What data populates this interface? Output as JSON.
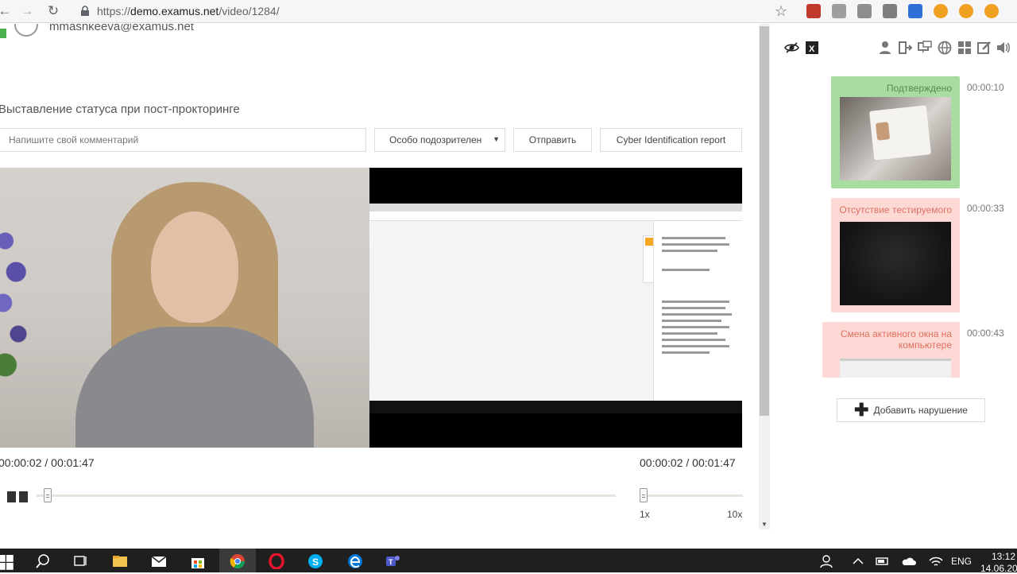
{
  "browser": {
    "url_scheme": "https://",
    "url_host": "demo.examus.net",
    "url_path": "/video/1284/"
  },
  "user": {
    "email": "mmashkeeva@examus.net"
  },
  "proctoring": {
    "section_title": "Выставление статуса при пост-прокторинге",
    "comment_placeholder": "Напишите свой комментарий",
    "status_selected": "Особо подозрителен",
    "send_label": "Отправить",
    "report_label": "Cyber Identification report"
  },
  "player": {
    "time_left": "00:00:02 / 00:01:47",
    "time_right": "00:00:02 / 00:01:47",
    "progress": 0.019,
    "speed_min_label": "1x",
    "speed_max_label": "10x",
    "speed_value": 1
  },
  "events": [
    {
      "title": "Подтверждено",
      "time": "00:00:10",
      "status": "confirmed",
      "color": "#a8dca0"
    },
    {
      "title": "Отсутствие тестируемого",
      "time": "00:00:33",
      "status": "violation",
      "color": "#fcd9d4"
    },
    {
      "title": "Смена активного окна на компьютере",
      "time": "00:00:43",
      "status": "violation",
      "color": "#fcd9d4"
    }
  ],
  "add_violation_label": "Добавить нарушение",
  "taskbar": {
    "language": "ENG",
    "time": "13:12",
    "date": "14.06.20"
  },
  "colors": {
    "confirmed_bg": "#a8dca0",
    "violation_bg": "#fcd9d4",
    "confirmed_text": "#5c8a55",
    "violation_text": "#e07060"
  },
  "icons": [
    "hide-icon",
    "excel-icon",
    "user-icon",
    "exit-icon",
    "chat-icon",
    "globe-icon",
    "grid-icon",
    "edit-icon",
    "sound-icon"
  ]
}
